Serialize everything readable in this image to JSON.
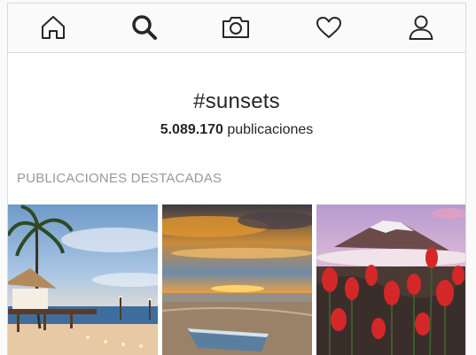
{
  "nav": {
    "items": [
      {
        "icon": "home-icon"
      },
      {
        "icon": "search-icon",
        "active": true
      },
      {
        "icon": "camera-icon"
      },
      {
        "icon": "heart-icon"
      },
      {
        "icon": "profile-icon"
      }
    ]
  },
  "tag": {
    "name": "#sunsets",
    "post_count": "5.089.170",
    "post_count_label": "publicaciones"
  },
  "section": {
    "title": "PUBLICACIONES DESTACADAS"
  },
  "posts": [
    {
      "subject": "tropical beach pier with palms and lanterns"
    },
    {
      "subject": "rowboat on beach under orange sunset sky"
    },
    {
      "subject": "red wildflowers in front of snowy volcano"
    }
  ],
  "colors": {
    "text": "#262626",
    "muted": "#999999",
    "border": "#dbdbdb",
    "nav_bg": "#fafafa"
  }
}
